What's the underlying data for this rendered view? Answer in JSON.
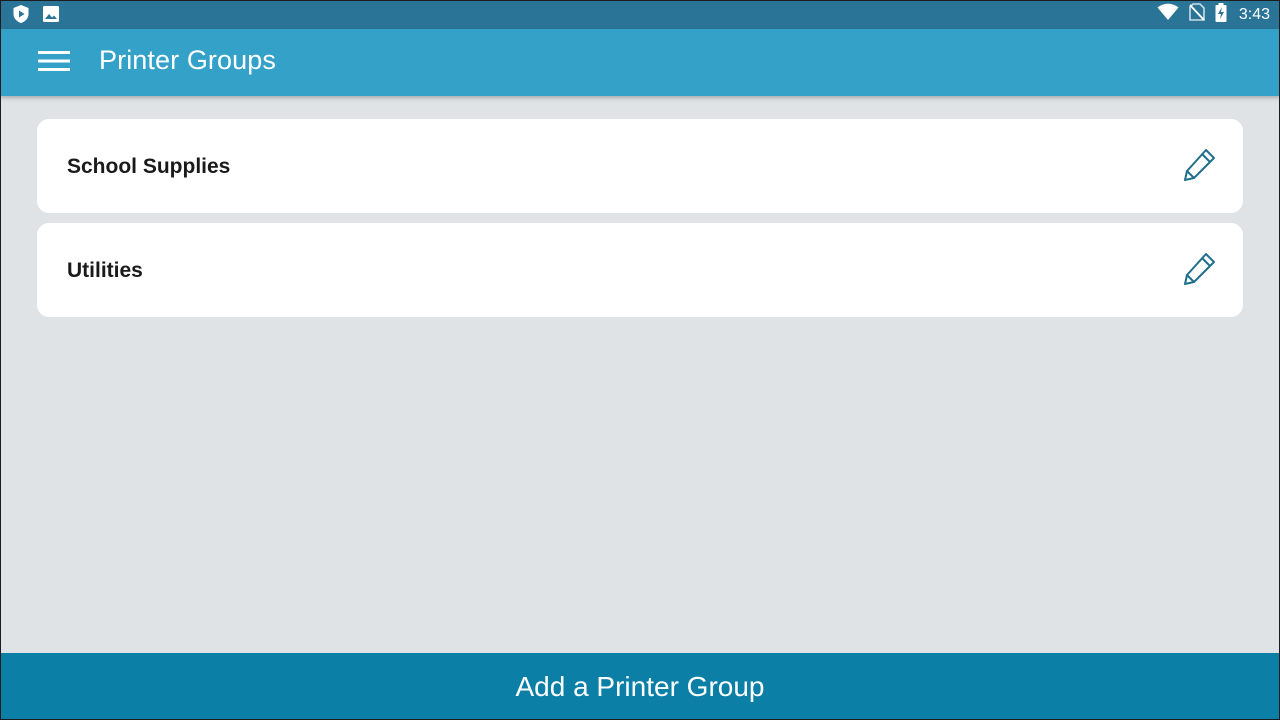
{
  "status_bar": {
    "time": "3:43",
    "left_icons": [
      "shield-play-icon",
      "image-icon"
    ],
    "right_icons": [
      "wifi-icon",
      "no-sim-icon",
      "battery-charging-icon"
    ]
  },
  "app_bar": {
    "title": "Printer Groups",
    "menu_icon": "hamburger-menu-icon"
  },
  "groups": [
    {
      "name": "School Supplies",
      "action_icon": "pencil-edit-icon"
    },
    {
      "name": "Utilities",
      "action_icon": "pencil-edit-icon"
    }
  ],
  "footer": {
    "add_label": "Add a Printer Group"
  },
  "colors": {
    "status_bar": "#2a7597",
    "app_bar": "#34a1c9",
    "background": "#dfe3e6",
    "card": "#ffffff",
    "accent_icon": "#1f6f8b",
    "add_button": "#0b7fa5"
  }
}
